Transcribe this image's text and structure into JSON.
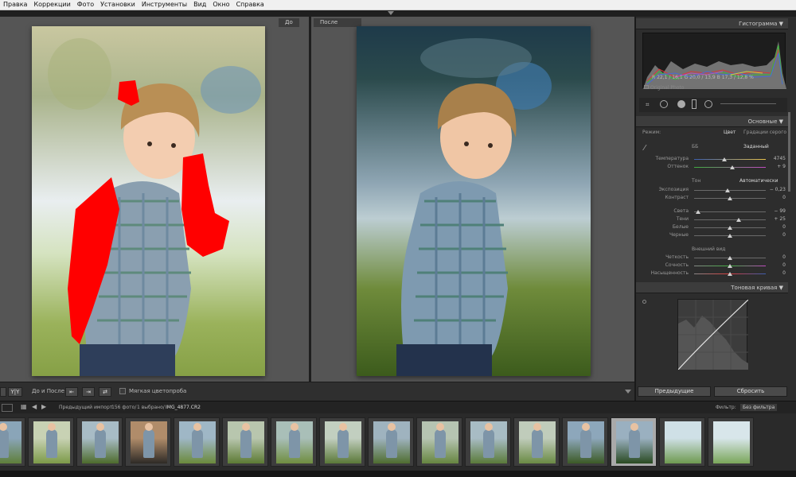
{
  "menu": [
    "Правка",
    "Коррекции",
    "Фото",
    "Установки",
    "Инструменты",
    "Вид",
    "Окно",
    "Справка"
  ],
  "labels": {
    "before": "До",
    "after": "После"
  },
  "histogram": {
    "title": "Гистограмма",
    "readout_r": "R",
    "readout_r_val": "22,1 / 16,1",
    "readout_g": "G",
    "readout_g_val": "20,0 / 13,9",
    "readout_b": "B",
    "readout_b_val": "17,3 / 12,8",
    "readout_pct": "%",
    "original_photo": "Original Photo"
  },
  "basic": {
    "title": "Основные",
    "mode_label": "Режим:",
    "mode_color": "Цвет",
    "mode_gray": "Градации серого",
    "wb_label": "ББ",
    "wb_value": "Заданный",
    "temperature": {
      "label": "Температура",
      "value": "4745",
      "pos": 0.42
    },
    "tint": {
      "label": "Оттенок",
      "value": "+ 9",
      "pos": 0.53
    },
    "tone_label": "Тон",
    "auto_label": "Автоматически",
    "exposure": {
      "label": "Экспозиция",
      "value": "− 0,23",
      "pos": 0.47
    },
    "contrast": {
      "label": "Контраст",
      "value": "0",
      "pos": 0.5
    },
    "highlights": {
      "label": "Света",
      "value": "− 99",
      "pos": 0.05
    },
    "shadows": {
      "label": "Тени",
      "value": "+ 25",
      "pos": 0.62
    },
    "whites": {
      "label": "Белые",
      "value": "0",
      "pos": 0.5
    },
    "blacks": {
      "label": "Черные",
      "value": "0",
      "pos": 0.5
    },
    "presence_label": "Внешний вид",
    "clarity": {
      "label": "Четкость",
      "value": "0",
      "pos": 0.5
    },
    "vibrance": {
      "label": "Сочность",
      "value": "0",
      "pos": 0.5
    },
    "saturation": {
      "label": "Насыщенность",
      "value": "0",
      "pos": 0.5
    }
  },
  "tone_curve": {
    "title": "Тоновая кривая"
  },
  "toolbar": {
    "view_label": "До и После :",
    "soft_proof": "Мягкая цветопроба"
  },
  "buttons": {
    "previous": "Предыдущие",
    "reset": "Сбросить"
  },
  "filmbar": {
    "source": "Предыдущий импорт",
    "count": "156 фото/",
    "selected": "1 выбрано/",
    "filename": "IMG_4877.CR2",
    "filter_label": "Фильтр:",
    "filter_value": "Без фильтра"
  },
  "thumbnails": [
    {
      "id": 1,
      "selected": false
    },
    {
      "id": 2,
      "selected": false
    },
    {
      "id": 3,
      "selected": false
    },
    {
      "id": 4,
      "selected": false
    },
    {
      "id": 5,
      "selected": false
    },
    {
      "id": 6,
      "selected": false
    },
    {
      "id": 7,
      "selected": false
    },
    {
      "id": 8,
      "selected": false
    },
    {
      "id": 9,
      "selected": false
    },
    {
      "id": 10,
      "selected": false
    },
    {
      "id": 11,
      "selected": false
    },
    {
      "id": 12,
      "selected": false
    },
    {
      "id": 13,
      "selected": false
    },
    {
      "id": 14,
      "selected": true
    },
    {
      "id": 15,
      "selected": false
    },
    {
      "id": 16,
      "selected": false
    }
  ],
  "colors": {
    "clip_highlight": "#ff0000",
    "accent": "#cfcfcf"
  }
}
